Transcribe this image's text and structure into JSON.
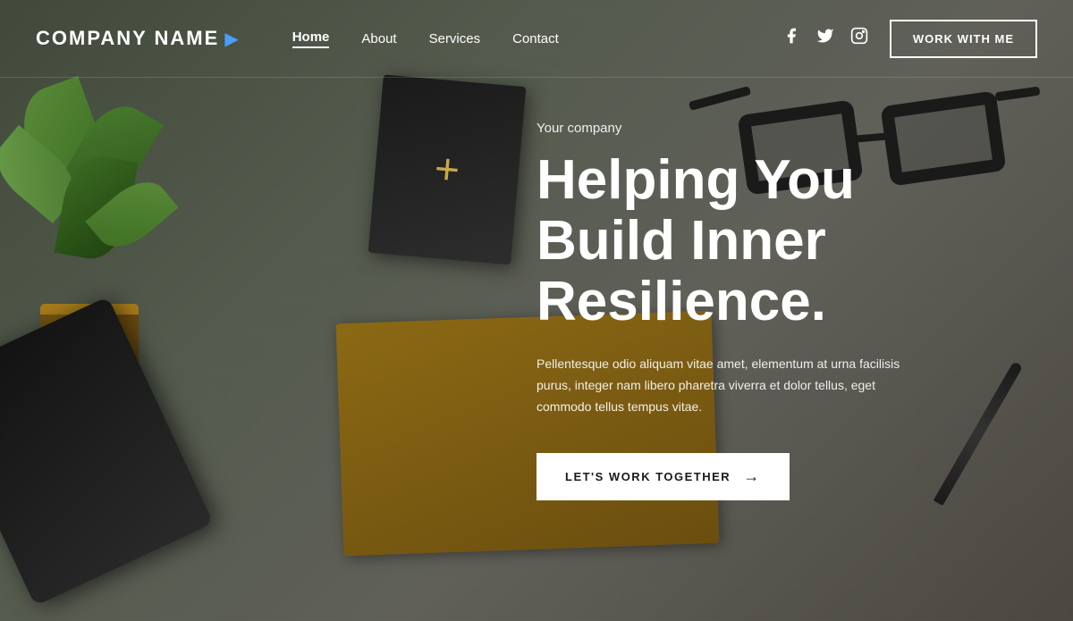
{
  "brand": {
    "name": "COMPANY NAME",
    "icon": "▶"
  },
  "nav": {
    "links": [
      {
        "label": "Home",
        "active": true
      },
      {
        "label": "About",
        "active": false
      },
      {
        "label": "Services",
        "active": false
      },
      {
        "label": "Contact",
        "active": false
      }
    ],
    "cta": "WORK WITH ME"
  },
  "social": {
    "facebook_label": "Facebook",
    "twitter_label": "Twitter",
    "instagram_label": "Instagram"
  },
  "hero": {
    "subtitle": "Your company",
    "title": "Helping You Build Inner Resilience.",
    "description": "Pellentesque odio aliquam vitae amet, elementum at urna facilisis purus, integer nam libero pharetra viverra et dolor tellus, eget commodo tellus tempus vitae.",
    "cta_label": "LET'S WORK TOGETHER",
    "cta_arrow": "→"
  }
}
